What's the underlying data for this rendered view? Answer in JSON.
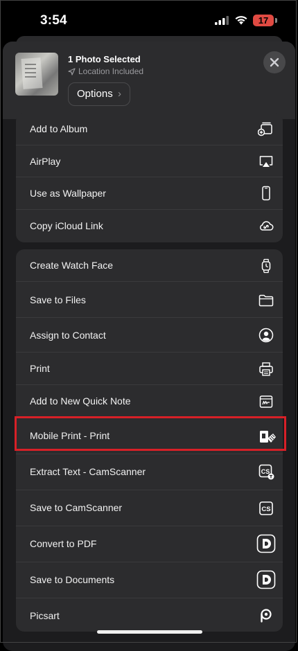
{
  "status_bar": {
    "time": "3:54",
    "battery": "17",
    "battery_color": "#e04a42"
  },
  "header": {
    "title": "1 Photo Selected",
    "location": "Location Included",
    "options_label": "Options",
    "options_chevron": "›"
  },
  "group1": [
    {
      "label": "Add to Album",
      "icon": "add-to-album-icon"
    },
    {
      "label": "AirPlay",
      "icon": "airplay-icon"
    },
    {
      "label": "Use as Wallpaper",
      "icon": "phone-icon"
    },
    {
      "label": "Copy iCloud Link",
      "icon": "icloud-link-icon"
    }
  ],
  "group2": [
    {
      "label": "Create Watch Face",
      "icon": "watch-icon"
    },
    {
      "label": "Save to Files",
      "icon": "folder-icon"
    },
    {
      "label": "Assign to Contact",
      "icon": "contact-icon"
    },
    {
      "label": "Print",
      "icon": "printer-icon"
    },
    {
      "label": "Add to New Quick Note",
      "icon": "quick-note-icon"
    },
    {
      "label": "Mobile Print - Print",
      "icon": "mobile-print-icon"
    },
    {
      "label": "Extract Text - CamScanner",
      "icon": "camscanner-text-icon"
    },
    {
      "label": "Save to CamScanner",
      "icon": "camscanner-icon"
    },
    {
      "label": "Convert to PDF",
      "icon": "documents-d-icon"
    },
    {
      "label": "Save to Documents",
      "icon": "documents-d-icon"
    },
    {
      "label": "Picsart",
      "icon": "picsart-icon"
    }
  ],
  "highlight_color": "#d82027"
}
